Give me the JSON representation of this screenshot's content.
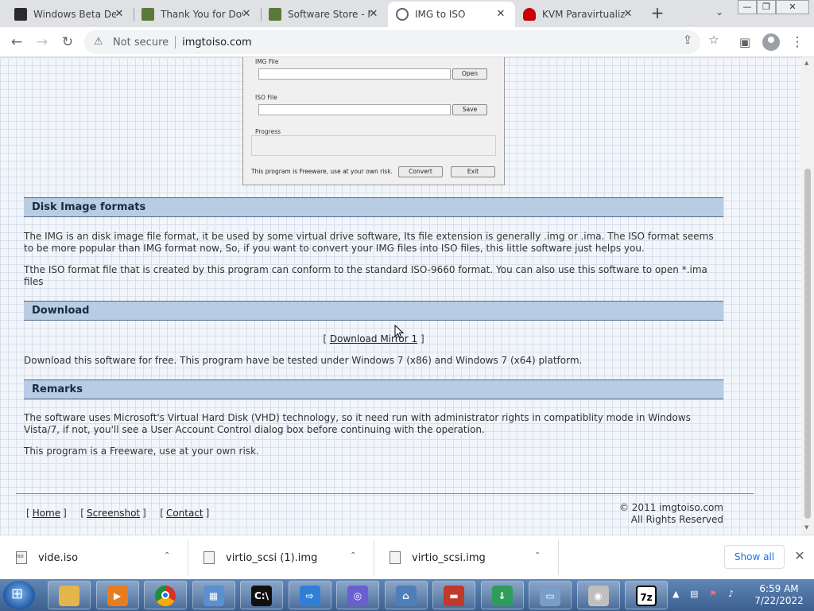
{
  "browser": {
    "tabs": [
      {
        "title": "Windows Beta Developer",
        "active": false,
        "favicon": "windows-tile-icon",
        "color": "#2b2b2b"
      },
      {
        "title": "Thank You for Downloading",
        "active": false,
        "favicon": "software-box-icon",
        "color": "#5a7a3a"
      },
      {
        "title": "Software Store - Microsoft",
        "active": false,
        "favicon": "software-box-icon",
        "color": "#5a7a3a"
      },
      {
        "title": "IMG to ISO",
        "active": true,
        "favicon": "globe-icon",
        "color": "#5f6368"
      },
      {
        "title": "KVM Paravirtualized",
        "active": false,
        "favicon": "redhat-icon",
        "color": "#cc0000"
      }
    ],
    "close_glyph": "✕",
    "new_tab_glyph": "+",
    "tab_search_glyph": "⌄",
    "window_controls": [
      "—",
      "❐",
      "✕"
    ],
    "toolbar": {
      "back": "←",
      "forward": "→",
      "reload": "↻",
      "security_label": "Not secure",
      "url": "imgtoiso.com",
      "share": "⇪",
      "bookmark": "☆",
      "sidepanel": "▣",
      "menu": "⋮"
    }
  },
  "page": {
    "app_screenshot": {
      "img_label": "IMG File",
      "open_button": "Open",
      "iso_label": "ISO File",
      "save_button": "Save",
      "progress_label": "Progress",
      "footer_text": "This program is Freeware, use at your own risk.",
      "convert_button": "Convert",
      "exit_button": "Exit"
    },
    "sections": {
      "formats_title": "Disk Image formats",
      "formats_p1": "The IMG is an disk image file format, it be used by some virtual drive software, Its file extension is generally .img or .ima. The ISO format seems to be more popular than IMG format now, So, if you want to convert your IMG files into ISO files, this little software just helps you.",
      "formats_p2": "Tthe ISO format file that is created by this program can conform to the standard ISO-9660 format. You can also use this software to open *.ima files",
      "download_title": "Download",
      "download_link_open": "[",
      "download_link": "Download Mirror 1",
      "download_link_close": "]",
      "download_p": "Download this software for free. This program have be tested under Windows 7 (x86) and Windows 7 (x64) platform.",
      "remarks_title": "Remarks",
      "remarks_p1": "The software uses Microsoft's Virtual Hard Disk (VHD) technology, so it need run with administrator rights in compatiblity mode in Windows Vista/7, if not, you'll see a User Account Control dialog box before continuing with the operation.",
      "remarks_p2": "This program is a Freeware, use at your own risk."
    },
    "footer": {
      "links": [
        "Home",
        "Screenshot",
        "Contact"
      ],
      "copyright_line1": "© 2011 imgtoiso.com",
      "copyright_line2": "All Rights Reserved"
    }
  },
  "downloads": {
    "items": [
      {
        "name": "vide.iso",
        "icon": "iso-file-icon"
      },
      {
        "name": "virtio_scsi (1).img",
        "icon": "img-file-icon"
      },
      {
        "name": "virtio_scsi.img",
        "icon": "img-file-icon"
      }
    ],
    "show_all": "Show all",
    "chevron": "⌃",
    "close": "✕"
  },
  "taskbar": {
    "apps": [
      {
        "name": "file-explorer-icon",
        "color": "#e3b54a",
        "glyph": ""
      },
      {
        "name": "media-player-icon",
        "color": "#e87c1e",
        "glyph": "▶"
      },
      {
        "name": "chrome-icon",
        "color": "#d93025",
        "glyph": ""
      },
      {
        "name": "control-panel-icon",
        "color": "#5b8fd1",
        "glyph": "▦"
      },
      {
        "name": "command-prompt-icon",
        "color": "#111111",
        "glyph": "C:\\"
      },
      {
        "name": "remote-desktop-icon",
        "color": "#2f7fd6",
        "glyph": "⇨"
      },
      {
        "name": "disc-burner-icon",
        "color": "#6a5fd0",
        "glyph": "◎"
      },
      {
        "name": "network-icon",
        "color": "#4f7fb8",
        "glyph": "⌂"
      },
      {
        "name": "toolbox-icon",
        "color": "#c0392b",
        "glyph": "▬"
      },
      {
        "name": "download-arrow-icon",
        "color": "#2f9c5a",
        "glyph": "⇓"
      },
      {
        "name": "drive-icon",
        "color": "#7a9cc8",
        "glyph": "▭"
      },
      {
        "name": "cd-icon",
        "color": "#bfbfbf",
        "glyph": "◉"
      },
      {
        "name": "7zip-icon",
        "color": "#ffffff",
        "glyph": "7z"
      }
    ],
    "tray": {
      "arrow": "▲",
      "network": "▤",
      "flag": "⚑",
      "volume": "♪",
      "time": "6:59 AM",
      "date": "7/22/2022"
    }
  }
}
